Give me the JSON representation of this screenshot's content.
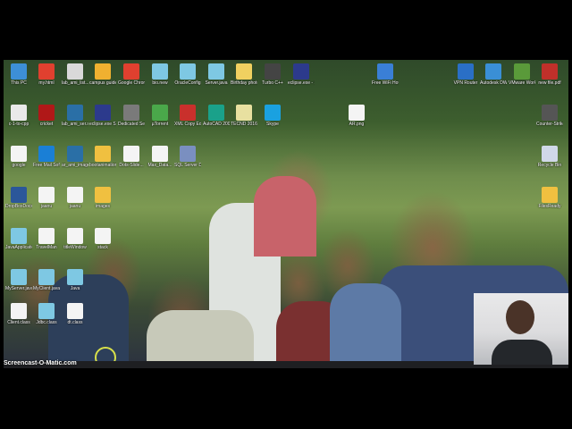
{
  "screen": {
    "recorder_watermark": "Screencast-O-Matic.com"
  },
  "desktop_icons": [
    {
      "name": "this-pc",
      "label": "This PC",
      "color": "#3d8fd6",
      "glyph": "pc-icon"
    },
    {
      "name": "chrome",
      "label": "my.html",
      "color": "#e0402f",
      "glyph": "chrome-icon"
    },
    {
      "name": "c-folder",
      "label": "lab_ami_list...",
      "color": "#d9d9d9",
      "glyph": "file-icon"
    },
    {
      "name": "campus-guide",
      "label": "campus guide -C#",
      "color": "#f0b030",
      "glyph": "folder-icon"
    },
    {
      "name": "google-chrome",
      "label": "Google Chrome",
      "color": "#e0402f",
      "glyph": "chrome-icon"
    },
    {
      "name": "document",
      "label": "bio.new",
      "color": "#7ec8e3",
      "glyph": "doc-icon"
    },
    {
      "name": "oracle",
      "label": "OracleConfig",
      "color": "#7ec8e3",
      "glyph": "doc-icon"
    },
    {
      "name": "server-java",
      "label": "Server.java",
      "color": "#7ec8e3",
      "glyph": "doc-icon"
    },
    {
      "name": "birthday-photos",
      "label": "Birthday photos",
      "color": "#f0d060",
      "glyph": "folder-icon"
    },
    {
      "name": "turbo-cpp",
      "label": "Turbo C++",
      "color": "#444",
      "glyph": "app-icon"
    },
    {
      "name": "eclipse",
      "label": "eclipse.exe - Shortcut",
      "color": "#2c3a8c",
      "glyph": "eclipse-icon"
    },
    {
      "name": "free-wifi",
      "label": "Free WiFi Hotspot",
      "color": "#3a7fd6",
      "glyph": "wifi-icon"
    },
    {
      "name": "vpn-router",
      "label": "VPN Router",
      "color": "#2a6fc6",
      "glyph": "router-icon"
    },
    {
      "name": "autodesk-viewer",
      "label": "Autodesk DWG Viewer",
      "color": "#3a8fd6",
      "glyph": "app-icon"
    },
    {
      "name": "vmware",
      "label": "VMware Workstation",
      "color": "#5a9a3a",
      "glyph": "vm-icon"
    },
    {
      "name": "pdf-file",
      "label": "new file.pdf",
      "color": "#c0302a",
      "glyph": "pdf-icon"
    },
    {
      "name": "c-doc",
      "label": "c-1-to-cpp",
      "color": "#e9e9e9",
      "glyph": "doc-icon"
    },
    {
      "name": "cricket",
      "label": "cricket",
      "color": "#b01818",
      "glyph": "ball-icon"
    },
    {
      "name": "flag-file",
      "label": "lab_ami_ser.ser",
      "color": "#2a6fa6",
      "glyph": "flag-icon"
    },
    {
      "name": "eclipse-shortcut",
      "label": "eclipse.exe Shortcut",
      "color": "#2c3a8c",
      "glyph": "eclipse-icon"
    },
    {
      "name": "dedicated-server",
      "label": "Dedicated Server",
      "color": "#7a7a7a",
      "glyph": "server-icon"
    },
    {
      "name": "utorrent",
      "label": "µTorrent",
      "color": "#4aa84a",
      "glyph": "utorrent-icon"
    },
    {
      "name": "xml-copy-editor",
      "label": "XML Copy Editor",
      "color": "#c9302c",
      "glyph": "xml-icon"
    },
    {
      "name": "autocad",
      "label": "AutoCAD 2007",
      "color": "#1aa18a",
      "glyph": "autocad-icon"
    },
    {
      "name": "tecnd",
      "label": "TECND 2016",
      "color": "#e8e0a0",
      "glyph": "doc-icon"
    },
    {
      "name": "skype",
      "label": "Skype",
      "color": "#1aa1e0",
      "glyph": "skype-icon"
    },
    {
      "name": "ar-png",
      "label": "AR.png",
      "color": "#f4f4f4",
      "glyph": "image-icon"
    },
    {
      "name": "counter-strike",
      "label": "Counter-Strike 1.6",
      "color": "#555",
      "glyph": "game-icon"
    },
    {
      "name": "doc-2",
      "label": "google",
      "color": "#f4f4f4",
      "glyph": "doc-icon"
    },
    {
      "name": "mail",
      "label": "Free Mail Software",
      "color": "#1a7fd6",
      "glyph": "mail-icon"
    },
    {
      "name": "flag-2",
      "label": "ar_ami_image",
      "color": "#2a6fa6",
      "glyph": "flag-icon"
    },
    {
      "name": "installer",
      "label": "bootanimation",
      "color": "#f0c040",
      "glyph": "package-icon"
    },
    {
      "name": "doc-3",
      "label": "Dots-Slide...",
      "color": "#f4f4f4",
      "glyph": "doc-icon"
    },
    {
      "name": "doc-4",
      "label": "Max_Data...",
      "color": "#f4f4f4",
      "glyph": "doc-icon"
    },
    {
      "name": "sql",
      "label": "SQL Server Data Tools",
      "color": "#7a8fc0",
      "glyph": "db-icon"
    },
    {
      "name": "recycle-bin",
      "label": "Recycle Bin",
      "color": "#d0d8e8",
      "glyph": "recycle-icon"
    },
    {
      "name": "word",
      "label": "DropBoxDocs",
      "color": "#2b579a",
      "glyph": "word-icon"
    },
    {
      "name": "doc-5",
      "label": "jaanu",
      "color": "#f4f4f4",
      "glyph": "doc-icon"
    },
    {
      "name": "doc-6",
      "label": "jaanu",
      "color": "#f4f4f4",
      "glyph": "doc-icon"
    },
    {
      "name": "folder-2",
      "label": "images",
      "color": "#f0c040",
      "glyph": "folder-icon"
    },
    {
      "name": "folder-3",
      "label": "FilesReady",
      "color": "#f0c040",
      "glyph": "folder-icon"
    },
    {
      "name": "doc-7",
      "label": "JavaApplication",
      "color": "#7ec8e3",
      "glyph": "doc-icon"
    },
    {
      "name": "doc-8",
      "label": "TravelMan",
      "color": "#f4f4f4",
      "glyph": "doc-icon"
    },
    {
      "name": "doc-9",
      "label": "titleWindow",
      "color": "#f4f4f4",
      "glyph": "doc-icon"
    },
    {
      "name": "doc-10",
      "label": "stack",
      "color": "#f4f4f4",
      "glyph": "doc-icon"
    },
    {
      "name": "doc-11",
      "label": "MyServer.java",
      "color": "#7ec8e3",
      "glyph": "doc-icon"
    },
    {
      "name": "doc-12",
      "label": "MyClient.java",
      "color": "#7ec8e3",
      "glyph": "doc-icon"
    },
    {
      "name": "doc-13",
      "label": "Java",
      "color": "#7ec8e3",
      "glyph": "doc-icon"
    },
    {
      "name": "doc-14",
      "label": "Client.class",
      "color": "#f4f4f4",
      "glyph": "doc-icon"
    },
    {
      "name": "doc-15",
      "label": "Jdbc.class",
      "color": "#7ec8e3",
      "glyph": "doc-icon"
    },
    {
      "name": "doc-16",
      "label": "dt.class",
      "color": "#f4f4f4",
      "glyph": "doc-icon"
    }
  ]
}
